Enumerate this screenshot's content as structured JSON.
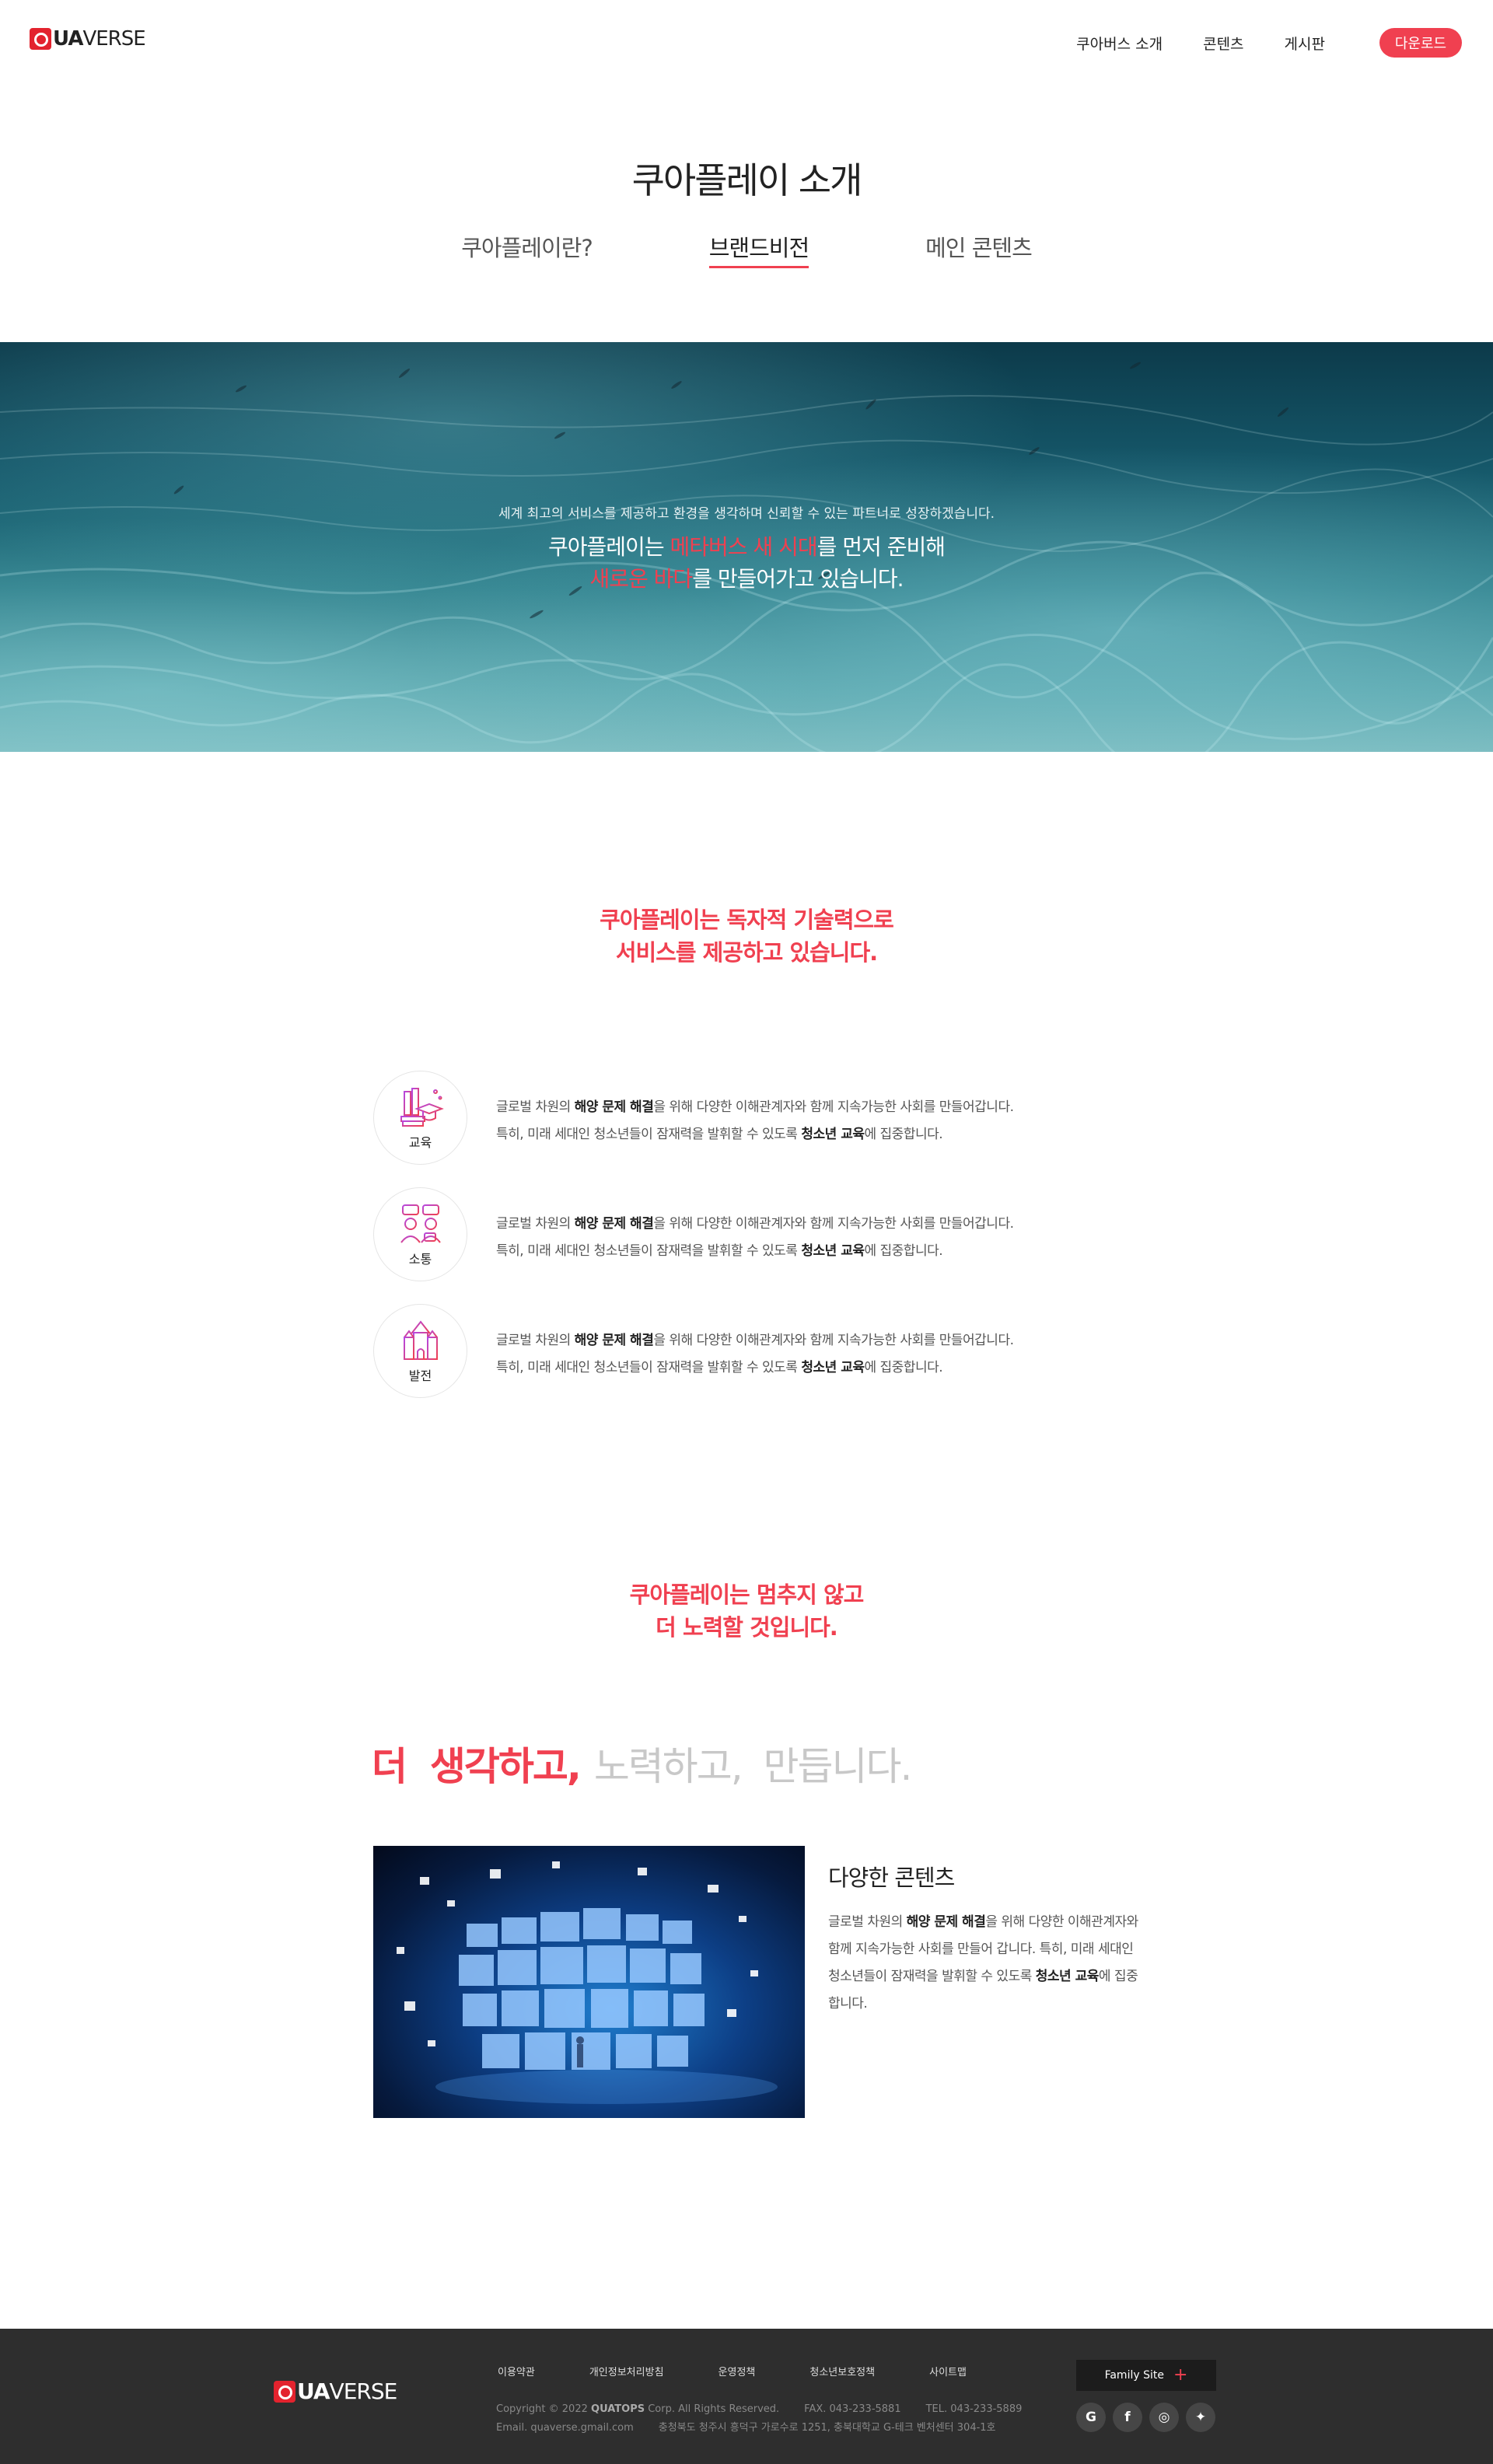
{
  "header": {
    "logo_q": "Q",
    "logo_ua": "UA",
    "logo_verse": "VERSE",
    "nav": [
      "쿠아버스 소개",
      "콘텐츠",
      "게시판"
    ],
    "download_label": "다운로드"
  },
  "intro": {
    "title": "쿠아플레이 소개",
    "tabs": [
      {
        "label": "쿠아플레이란?",
        "active": false
      },
      {
        "label": "브랜드비전",
        "active": true
      },
      {
        "label": "메인 콘텐츠",
        "active": false
      }
    ]
  },
  "hero": {
    "subtitle": "세계 최고의 서비스를 제공하고 환경을 생각하며 신뢰할 수 있는 파트너로 성장하겠습니다.",
    "line1_pre": "쿠아플레이는 ",
    "line1_hl": "메타버스 새 시대",
    "line1_post": "를 먼저 준비해",
    "line2_hl": "새로운 바다",
    "line2_post": "를 만들어가고 있습니다."
  },
  "tech": {
    "heading_line1": "쿠아플레이는 독자적 기술력으로",
    "heading_line2": "서비스를 제공하고 있습니다.",
    "features": [
      {
        "label": "교육",
        "icon": "education-icon",
        "t1": "글로벌 차원의 ",
        "b1": "해양 문제 해결",
        "t2": "을 위해 다양한 이해관계자와 함께 지속가능한 사회를 만들어갑니다.",
        "t3": "특히, 미래 세대인 청소년들이 잠재력을 발휘할 수 있도록 ",
        "b2": "청소년 교육",
        "t4": "에 집중합니다."
      },
      {
        "label": "소통",
        "icon": "communication-icon",
        "t1": "글로벌 차원의 ",
        "b1": "해양 문제 해결",
        "t2": "을 위해 다양한 이해관계자와 함께 지속가능한 사회를 만들어갑니다.",
        "t3": "특히, 미래 세대인 청소년들이 잠재력을 발휘할 수 있도록 ",
        "b2": "청소년 교육",
        "t4": "에 집중합니다."
      },
      {
        "label": "발전",
        "icon": "development-icon",
        "t1": "글로벌 차원의 ",
        "b1": "해양 문제 해결",
        "t2": "을 위해 다양한 이해관계자와 함께 지속가능한 사회를 만들어갑니다.",
        "t3": "특히, 미래 세대인 청소년들이 잠재력을 발휘할 수 있도록 ",
        "b2": "청소년 교육",
        "t4": "에 집중합니다."
      }
    ]
  },
  "effort": {
    "heading_line1": "쿠아플레이는 멈추지 않고",
    "heading_line2": "더 노력할 것입니다.",
    "slogan_red": "더  생각하고,",
    "slogan_gray": "노력하고,  만듭니다."
  },
  "content": {
    "title": "다양한 콘텐츠",
    "t1": "글로벌 차원의 ",
    "b1": "해양 문제 해결",
    "t2": "을 위해 다양한 이해관계자와 함께 지속가능한 사회를 만들어 갑니다.",
    "t3": "특히, 미래 세대인 청소년들이 잠재력을 발휘할 수 있도록 ",
    "b2": "청소년 교육",
    "t4": "에 집중합니다."
  },
  "footer": {
    "links": [
      "이용약관",
      "개인정보처리방침",
      "운영정책",
      "청소년보호정책",
      "사이트맵"
    ],
    "copyright_pre": "Copyright © 2022 ",
    "copyright_company": "QUATOPS",
    "copyright_post": " Corp. All Rights Reserved.",
    "fax": "FAX. 043-233-5881",
    "tel": "TEL. 043-233-5889",
    "email": "Email. quaverse.gmail.com",
    "address": "충청북도 청주시 흥덕구 가로수로 1251, 충북대학교 G-테크 벤처센터 304-1호",
    "family_site": "Family Site",
    "family_plus": "+",
    "social": [
      {
        "icon": "google-icon",
        "glyph": "G"
      },
      {
        "icon": "facebook-icon",
        "glyph": "f"
      },
      {
        "icon": "instagram-icon",
        "glyph": "◎"
      },
      {
        "icon": "twitter-icon",
        "glyph": "✦"
      }
    ]
  },
  "colors": {
    "accent": "#f04050",
    "footer_bg": "#2e2e2e",
    "slogan_gray": "#c8c8c8"
  }
}
